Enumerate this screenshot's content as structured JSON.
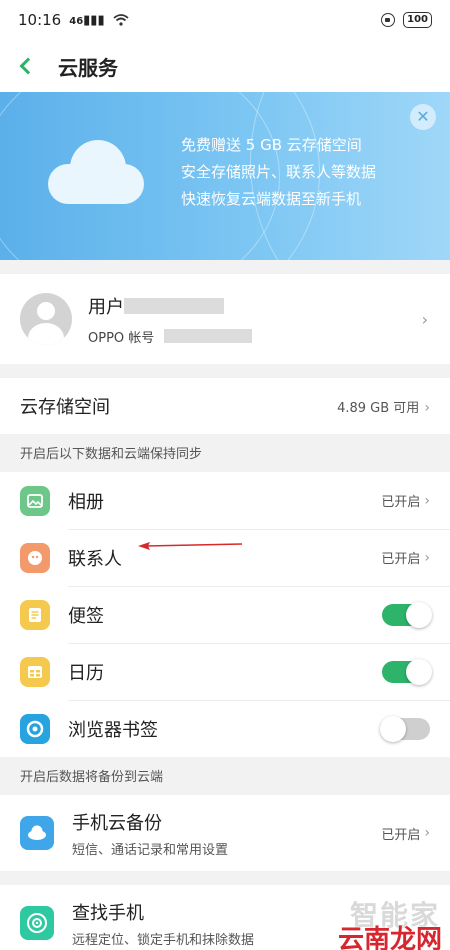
{
  "status_bar": {
    "time": "10:16",
    "signal": "46",
    "battery": "100"
  },
  "nav": {
    "title": "云服务"
  },
  "banner": {
    "lines": [
      "免费赠送 5 GB 云存储空间",
      "安全存储照片、联系人等数据",
      "快速恢复云端数据至新手机"
    ]
  },
  "account": {
    "name_prefix": "用户",
    "sub_label": "OPPO 帐号"
  },
  "storage": {
    "label": "云存储空间",
    "value": "4.89 GB 可用"
  },
  "sync_section": {
    "header": "开启后以下数据和云端保持同步",
    "items": [
      {
        "label": "相册",
        "status": "已开启",
        "control": "chevron",
        "icon": "album-icon",
        "color": "#6cc789"
      },
      {
        "label": "联系人",
        "status": "已开启",
        "control": "chevron",
        "icon": "contacts-icon",
        "color": "#f39a6c"
      },
      {
        "label": "便签",
        "control": "toggle",
        "on": true,
        "icon": "notes-icon",
        "color": "#f5c84e"
      },
      {
        "label": "日历",
        "control": "toggle",
        "on": true,
        "icon": "calendar-icon",
        "color": "#f5c84e"
      },
      {
        "label": "浏览器书签",
        "control": "toggle",
        "on": false,
        "icon": "browser-icon",
        "color": "#27a3e0"
      }
    ]
  },
  "backup_section": {
    "header": "开启后数据将备份到云端",
    "item": {
      "title": "手机云备份",
      "subtitle": "短信、通话记录和常用设置",
      "status": "已开启"
    }
  },
  "find_phone": {
    "title": "查找手机",
    "subtitle": "远程定位、锁定手机和抹除数据"
  },
  "watermarks": {
    "faint": "智能家",
    "brand": "云南龙网"
  },
  "colors": {
    "accent": "#2eb36b",
    "banner": "#6dbdf0",
    "annotation_arrow": "#d62a2a"
  }
}
